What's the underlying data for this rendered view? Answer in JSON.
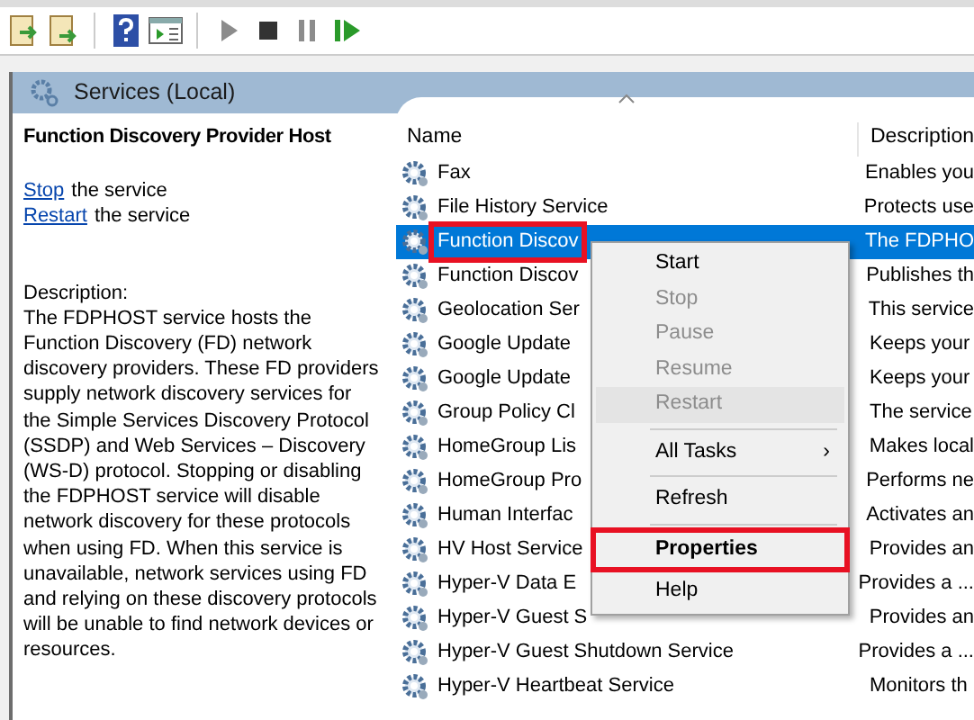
{
  "toolbar": {
    "buttons": [
      {
        "kind": "export"
      },
      {
        "kind": "export2"
      },
      {
        "kind": "sep"
      },
      {
        "kind": "help"
      },
      {
        "kind": "console"
      },
      {
        "kind": "sep"
      },
      {
        "kind": "play"
      },
      {
        "kind": "stop"
      },
      {
        "kind": "pause"
      },
      {
        "kind": "restart"
      }
    ]
  },
  "panel_title": "Services (Local)",
  "details": {
    "title": "Function Discovery Provider Host",
    "actions": [
      {
        "link": "Stop",
        "text": "the service"
      },
      {
        "link": "Restart",
        "text": "the service"
      }
    ],
    "description_label": "Description:",
    "description": "The FDPHOST service hosts the Function Discovery (FD) network discovery providers. These FD providers supply network discovery services for the Simple Services Discovery Protocol (SSDP) and Web Services – Discovery (WS-D) protocol. Stopping or disabling the FDPHOST service will disable network discovery for these protocols when using FD. When this service is unavailable, network services using FD and relying on these discovery protocols will be unable to find network devices or resources."
  },
  "table": {
    "columns": [
      "Name",
      "Description"
    ],
    "rows": [
      {
        "name": "Fax",
        "description": "Enables you",
        "selected": false,
        "annotated": false
      },
      {
        "name": "File History Service",
        "description": "Protects use",
        "selected": false,
        "annotated": false
      },
      {
        "name": "Function Discov",
        "description": "The FDPHO",
        "selected": true,
        "annotated": true
      },
      {
        "name": "Function Discov",
        "description": "Publishes th",
        "selected": false,
        "annotated": false
      },
      {
        "name": "Geolocation Ser",
        "description": "This service",
        "selected": false,
        "annotated": false
      },
      {
        "name": "Google Update",
        "description": "Keeps your",
        "selected": false,
        "annotated": false
      },
      {
        "name": "Google Update",
        "description": "Keeps your",
        "selected": false,
        "annotated": false
      },
      {
        "name": "Group Policy Cl",
        "description": "The service",
        "selected": false,
        "annotated": false
      },
      {
        "name": "HomeGroup Lis",
        "description": "Makes local",
        "selected": false,
        "annotated": false
      },
      {
        "name": "HomeGroup Pro",
        "description": "Performs ne",
        "selected": false,
        "annotated": false
      },
      {
        "name": "Human Interfac",
        "description": "Activates an",
        "selected": false,
        "annotated": false
      },
      {
        "name": "HV Host Service",
        "description": "Provides an",
        "selected": false,
        "annotated": false
      },
      {
        "name": "Hyper-V Data E",
        "description": "Provides a ...",
        "selected": false,
        "annotated": false
      },
      {
        "name": "Hyper-V Guest S",
        "description": "Provides an",
        "selected": false,
        "annotated": false
      },
      {
        "name": "Hyper-V Guest Shutdown Service",
        "description": "Provides a ...",
        "selected": false,
        "annotated": false
      },
      {
        "name": "Hyper-V Heartbeat Service",
        "description": "Monitors th",
        "selected": false,
        "annotated": false
      }
    ]
  },
  "context_menu": {
    "items": [
      {
        "kind": "item",
        "label": "Start",
        "disabled": false,
        "hovered": false,
        "default": false,
        "annotated": false
      },
      {
        "kind": "item",
        "label": "Stop",
        "disabled": true,
        "hovered": false,
        "default": false,
        "annotated": false
      },
      {
        "kind": "item",
        "label": "Pause",
        "disabled": true,
        "hovered": false,
        "default": false,
        "annotated": false
      },
      {
        "kind": "item",
        "label": "Resume",
        "disabled": true,
        "hovered": false,
        "default": false,
        "annotated": false
      },
      {
        "kind": "item",
        "label": "Restart",
        "disabled": true,
        "hovered": true,
        "default": false,
        "annotated": false
      },
      {
        "kind": "separator"
      },
      {
        "kind": "submenu",
        "label": "All Tasks",
        "arrow": "›",
        "disabled": false,
        "hovered": false,
        "default": false,
        "annotated": false
      },
      {
        "kind": "separator"
      },
      {
        "kind": "item",
        "label": "Refresh",
        "disabled": false,
        "hovered": false,
        "default": false,
        "annotated": false
      },
      {
        "kind": "separator"
      },
      {
        "kind": "item",
        "label": "Properties",
        "disabled": false,
        "hovered": false,
        "default": true,
        "annotated": true
      },
      {
        "kind": "item",
        "label": "Help",
        "disabled": false,
        "hovered": false,
        "default": false,
        "annotated": false
      }
    ]
  }
}
